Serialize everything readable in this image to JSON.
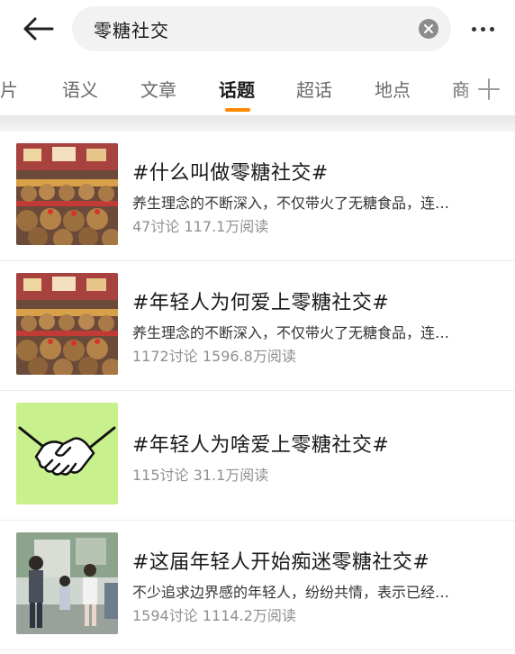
{
  "search": {
    "query": "零糖社交"
  },
  "icons": {
    "back": "arrow-left-icon",
    "clear": "clear-x-icon",
    "more": "more-dots-icon",
    "add": "plus-icon"
  },
  "colors": {
    "accent": "#ff8a00",
    "thumb_green": "#c8f08c"
  },
  "tabs": [
    {
      "label": "图片"
    },
    {
      "label": "语义"
    },
    {
      "label": "文章"
    },
    {
      "label": "话题",
      "active": true
    },
    {
      "label": "超话"
    },
    {
      "label": "地点"
    },
    {
      "label": "商"
    }
  ],
  "topics": [
    {
      "title": "#什么叫做零糖社交#",
      "desc": "养生理念的不断深入，不仅带火了无糖食品，连…",
      "discussions": "47讨论",
      "reads": "117.1万阅读"
    },
    {
      "title": "#年轻人为何爱上零糖社交#",
      "desc": "养生理念的不断深入，不仅带火了无糖食品，连…",
      "discussions": "1172讨论",
      "reads": "1596.8万阅读"
    },
    {
      "title": "#年轻人为啥爱上零糖社交#",
      "desc": "",
      "discussions": "115讨论",
      "reads": "31.1万阅读"
    },
    {
      "title": "#这届年轻人开始痴迷零糖社交#",
      "desc": "不少追求边界感的年轻人，纷纷共情，表示已经…",
      "discussions": "1594讨论",
      "reads": "1114.2万阅读"
    }
  ]
}
